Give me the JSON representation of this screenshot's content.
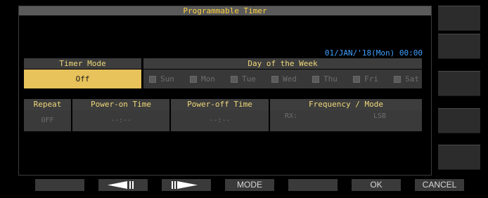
{
  "window": {
    "title": "Programmable Timer"
  },
  "datetime": "01/JAN/'18(Mon) 00:00",
  "timer_mode": {
    "header": "Timer Mode",
    "value": "Off"
  },
  "day_of_week": {
    "header": "Day of the Week",
    "days": [
      {
        "label": "Sun",
        "checked": false
      },
      {
        "label": "Mon",
        "checked": false
      },
      {
        "label": "Tue",
        "checked": false
      },
      {
        "label": "Wed",
        "checked": false
      },
      {
        "label": "Thu",
        "checked": false
      },
      {
        "label": "Fri",
        "checked": false
      },
      {
        "label": "Sat",
        "checked": false
      }
    ]
  },
  "table": {
    "headers": {
      "repeat": "Repeat",
      "power_on": "Power-on Time",
      "power_off": "Power-off Time",
      "freq_mode": "Frequency / Mode"
    },
    "row": {
      "repeat": "OFF",
      "power_on": "--:--",
      "power_off": "--:--",
      "rx": "RX:",
      "mode": "LSB"
    }
  },
  "bottom_keys": {
    "k1": "",
    "k2_icon": "left-arrow-icon",
    "k3_icon": "right-arrow-icon",
    "k4": "MODE",
    "k5": "",
    "k6": "OK",
    "k7": "CANCEL"
  },
  "colors": {
    "title_text": "#ffd23f",
    "header_text": "#f0d87a",
    "selected_bg": "#e8c25a",
    "datetime_text": "#3fa0ff"
  }
}
